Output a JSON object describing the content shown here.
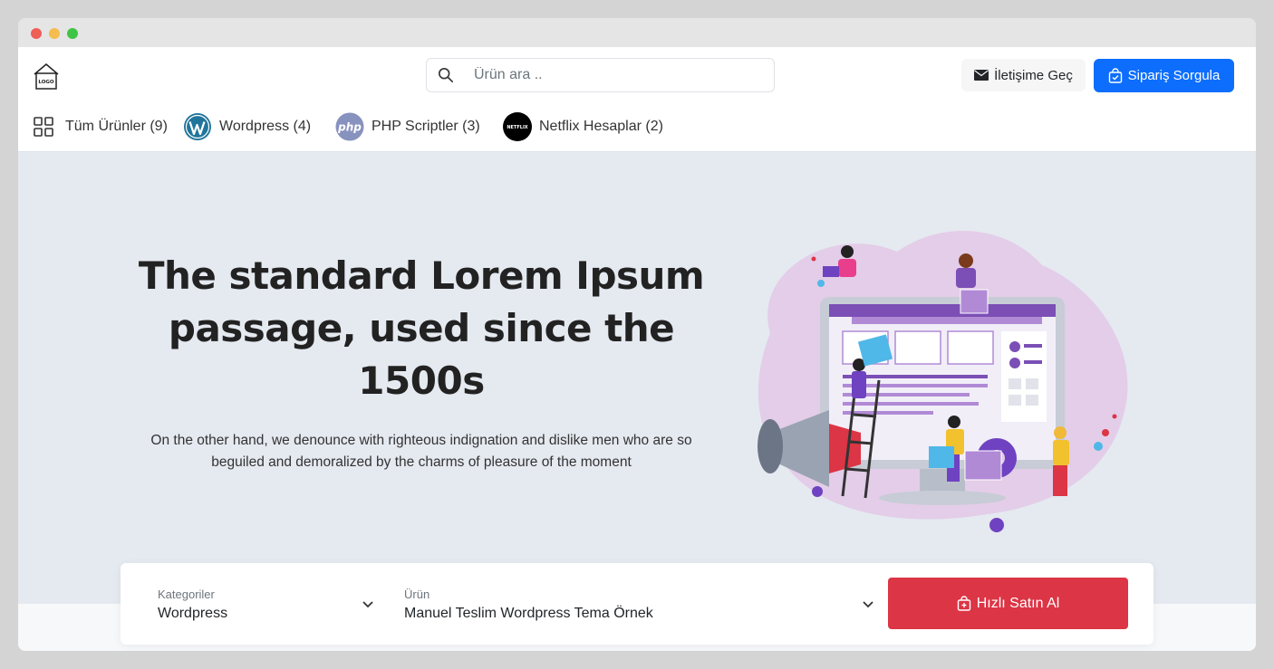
{
  "window": {
    "controls": [
      "close",
      "minimize",
      "maximize"
    ]
  },
  "header": {
    "logo_text": "LOGO",
    "search": {
      "placeholder": "Ürün ara ..",
      "value": ""
    },
    "contact_label": "İletişime Geç",
    "order_label": "Sipariş Sorgula"
  },
  "categories": [
    {
      "label": "Tüm Ürünler (9)",
      "icon": "grid-icon"
    },
    {
      "label": "Wordpress (4)",
      "icon": "wordpress-icon"
    },
    {
      "label": "PHP Scriptler (3)",
      "icon": "php-icon",
      "icon_text": "php"
    },
    {
      "label": "Netflix Hesaplar (2)",
      "icon": "netflix-icon",
      "icon_text": "NETFLIX"
    }
  ],
  "hero": {
    "title": "The standard Lorem Ipsum passage, used since the 1500s",
    "text": "On the other hand, we denounce with righteous indignation and dislike men who are so beguiled and demoralized by the charms of pleasure of the moment"
  },
  "order_form": {
    "category": {
      "label": "Kategoriler",
      "value": "Wordpress"
    },
    "product": {
      "label": "Ürün",
      "value": "Manuel Teslim Wordpress Tema Örnek"
    },
    "buy_label": "Hızlı Satın Al"
  },
  "colors": {
    "primary": "#0d6efd",
    "danger": "#dc3545",
    "hero_bg": "#e5e9f0",
    "illustration_purple": "#7b4fb5"
  }
}
